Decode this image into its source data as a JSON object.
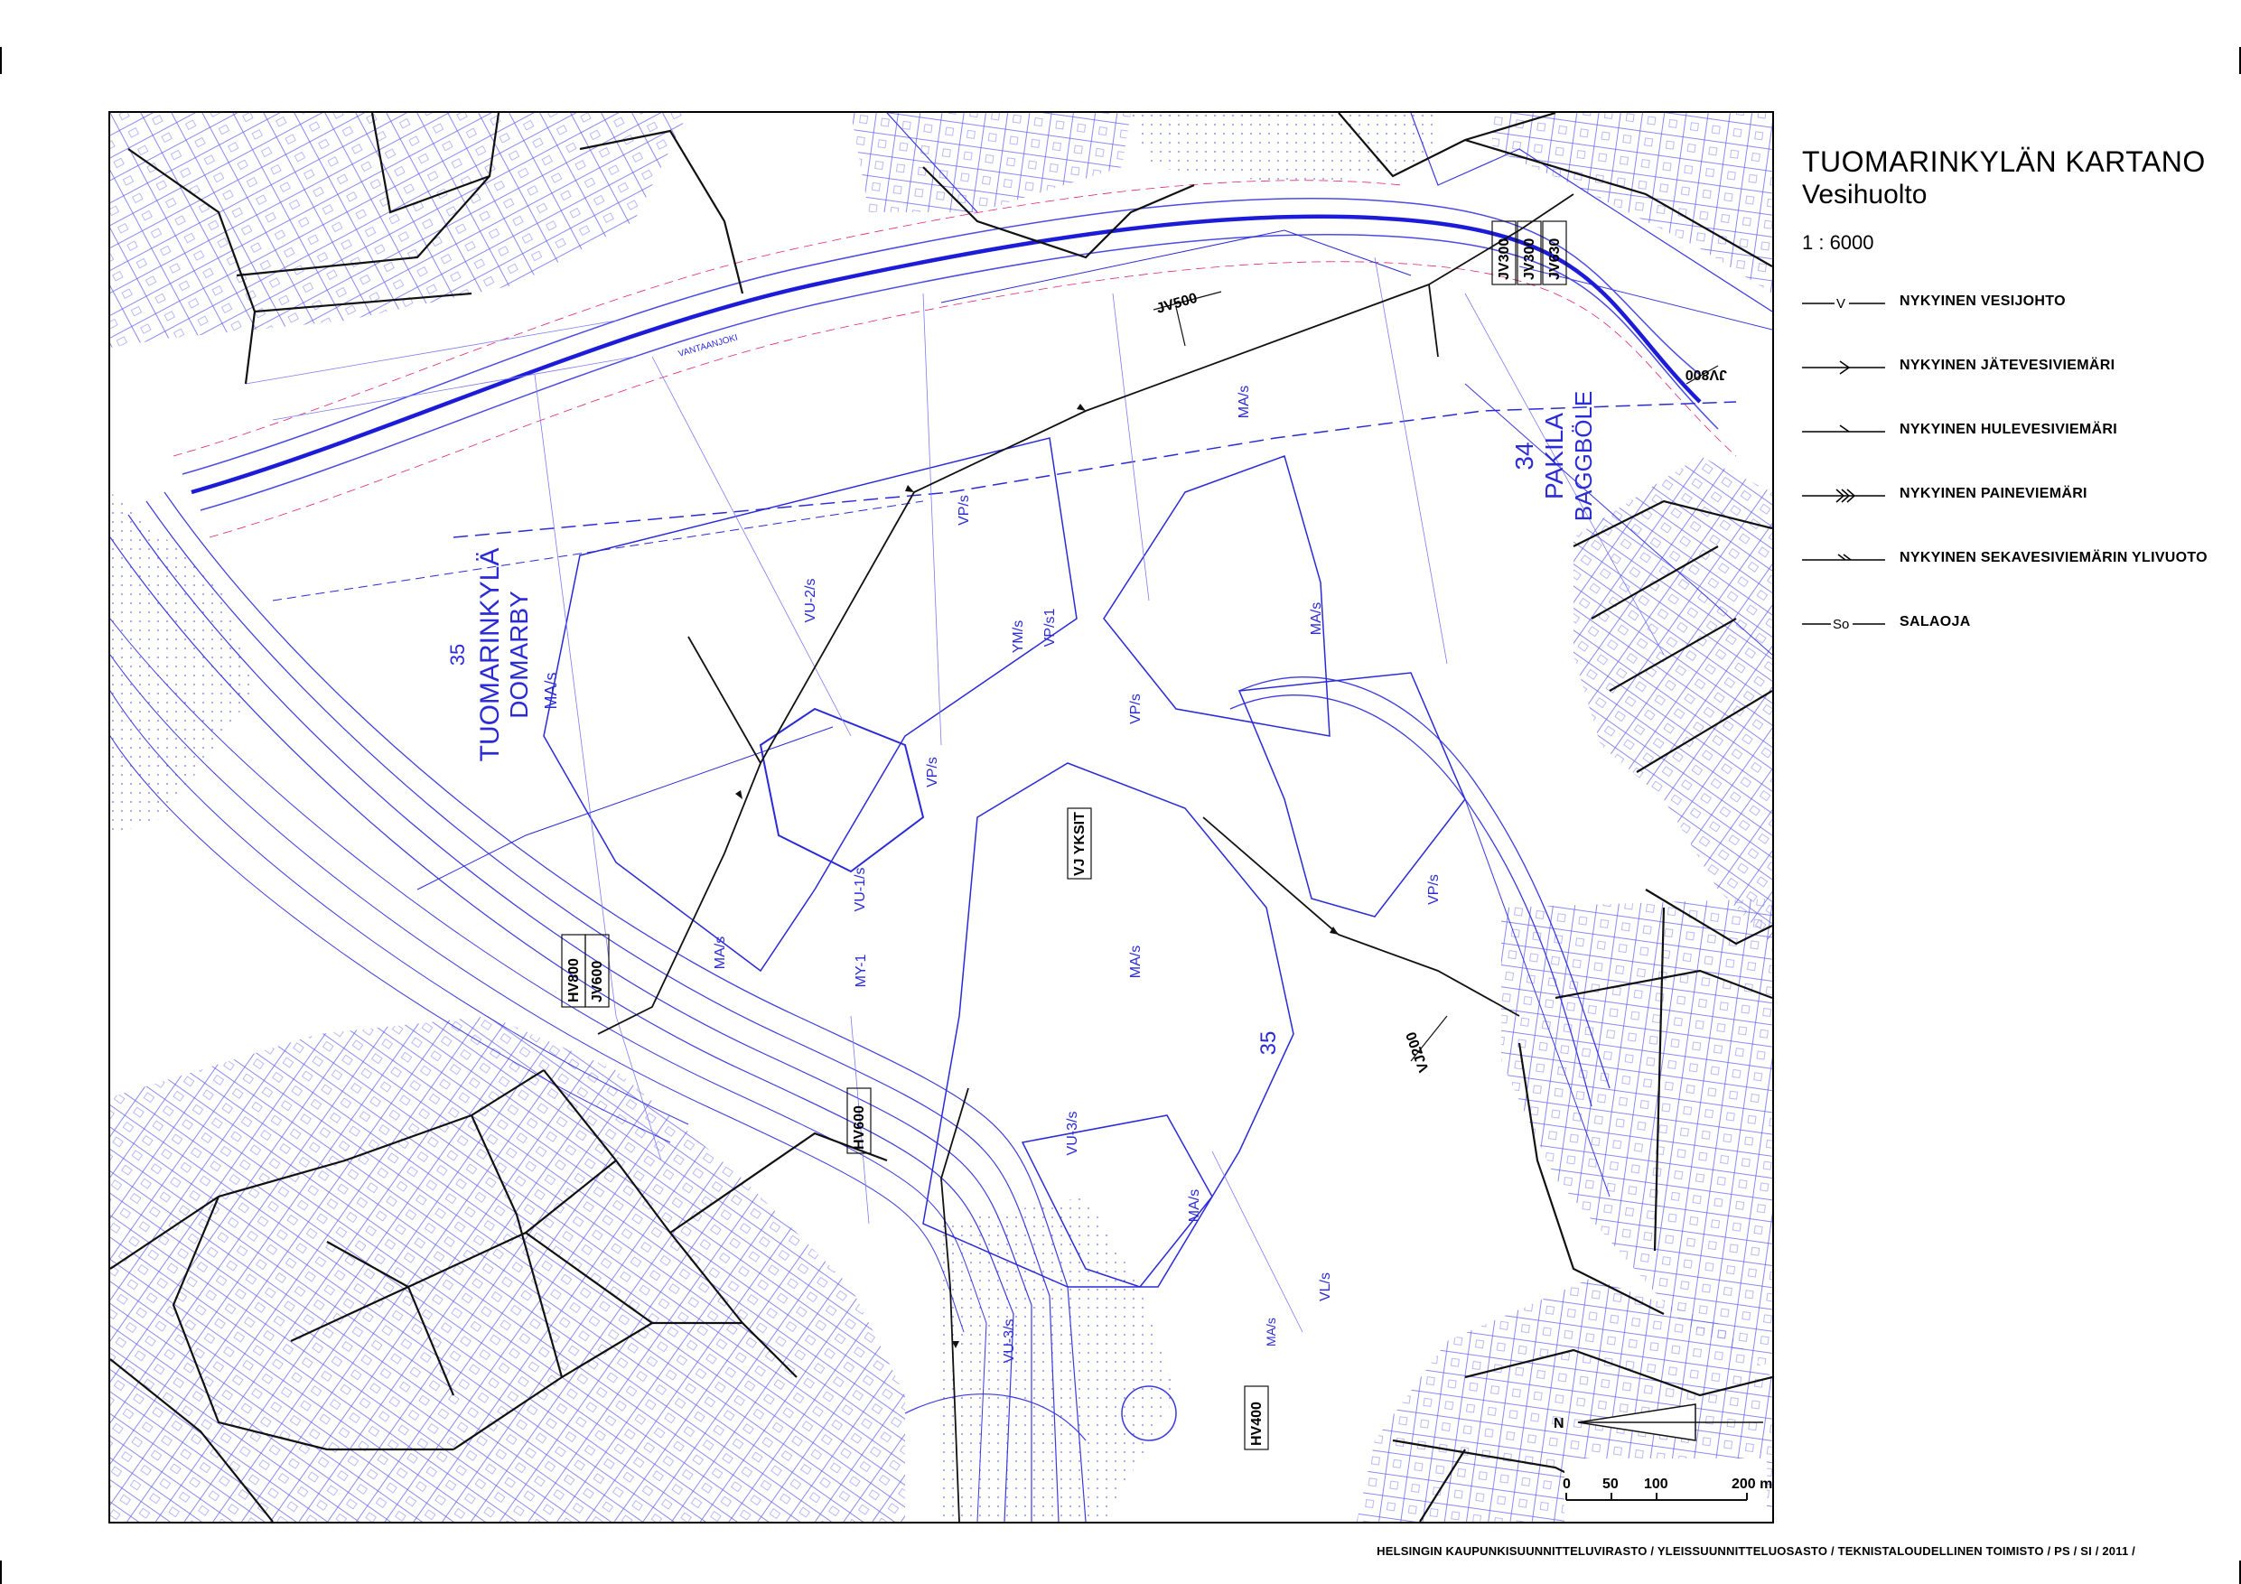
{
  "title": {
    "main": "TUOMARINKYLÄN KARTANO",
    "sub": "Vesihuolto",
    "scale": "1 : 6000"
  },
  "legend": [
    {
      "label": "NYKYINEN VESIJOHTO",
      "symbol": "vesijohto-line-icon",
      "marker": "V"
    },
    {
      "label": "NYKYINEN JÄTEVESIVIEMÄRI",
      "symbol": "jatevesi-line-icon"
    },
    {
      "label": "NYKYINEN HULEVESIVIEMÄRI",
      "symbol": "hulevesi-line-icon"
    },
    {
      "label": "NYKYINEN PAINEVIEMÄRI",
      "symbol": "paineviemari-line-icon"
    },
    {
      "label": "NYKYINEN SEKAVESIVIEMÄRIN YLIVUOTO",
      "symbol": "ylivuoto-line-icon"
    },
    {
      "label": "SALAOJA",
      "symbol": "salaoja-line-icon",
      "marker": "So"
    }
  ],
  "map": {
    "areas": {
      "num35": "35",
      "tuomarinkyla": "TUOMARINKYLÄ",
      "domarby": "DOMARBY",
      "ma_s": "MA/s",
      "num34": "34",
      "pakila": "PAKILA",
      "baggbole": "BAGGBÖLE",
      "num35b": "35"
    },
    "zones": {
      "vu2": "VU-2/s",
      "vu1": "VU-1/s",
      "my1": "MY-1",
      "ym": "YM/s",
      "vp_s1": "VP/s1",
      "vp_a": "VP/s",
      "vp_b": "VP/s",
      "vp_c": "VP/s",
      "vp_d": "VP/s",
      "ma1": "MA/s",
      "ma2": "MA/s",
      "ma3": "MA/s",
      "ma4": "MA/s",
      "ma5": "MA/s",
      "ma6": "MA/s",
      "vu3a": "VU-3/s",
      "vu3b": "VU-3/s",
      "vl": "VL/s"
    },
    "pipe_tags": {
      "jv500": "JV500",
      "jv300": "JV300",
      "jv3": "JV300",
      "jv630": "JV630",
      "jv800": "JV800",
      "hv800": "HV800",
      "jv600": "JV600",
      "vj_yksit": "VJ YKSIT",
      "vj200": "VJ200",
      "hv600": "HV600",
      "hv400": "HV400"
    },
    "river": "VANTAANJOKI",
    "north_arrow": "N",
    "scale_bar": [
      "0",
      "50",
      "100",
      "200 m"
    ]
  },
  "footer": "HELSINGIN KAUPUNKISUUNNITTELUVIRASTO / YLEISSUUNNITTELUOSASTO / TEKNISTALOUDELLINEN TOIMISTO / PS  / SI  / 2011      /"
}
